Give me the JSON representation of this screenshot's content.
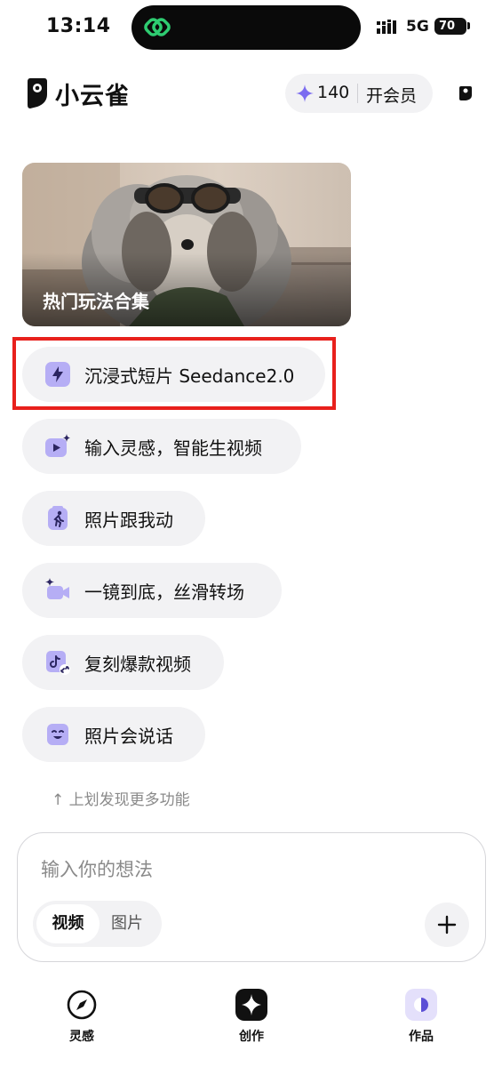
{
  "status_bar": {
    "time": "13:14",
    "network": "5G",
    "battery": "70"
  },
  "header": {
    "app_name": "小云雀",
    "credits": "140",
    "member_button": "开会员"
  },
  "banner": {
    "title": "热门玩法合集"
  },
  "features": [
    {
      "label": "沉浸式短片 Seedance2.0",
      "icon": "lightning-icon"
    },
    {
      "label": "输入灵感，智能生视频",
      "icon": "video-sparkle-icon"
    },
    {
      "label": "照片跟我动",
      "icon": "running-person-icon"
    },
    {
      "label": "一镜到底，丝滑转场",
      "icon": "camera-sparkle-icon"
    },
    {
      "label": "复刻爆款视频",
      "icon": "tiktok-link-icon"
    },
    {
      "label": "照片会说话",
      "icon": "smiling-face-icon"
    }
  ],
  "swipe_hint": "↑ 上划发现更多功能",
  "composer": {
    "placeholder": "输入你的想法",
    "mode_tabs": [
      "视频",
      "图片"
    ],
    "active_mode": "视频"
  },
  "bottom_nav": [
    {
      "label": "灵感",
      "icon": "compass-icon"
    },
    {
      "label": "创作",
      "icon": "sparkle-icon"
    },
    {
      "label": "作品",
      "icon": "works-icon"
    }
  ],
  "colors": {
    "accent": "#7b6cf0",
    "highlight": "#e8201c",
    "pill_bg": "#f2f2f4"
  }
}
